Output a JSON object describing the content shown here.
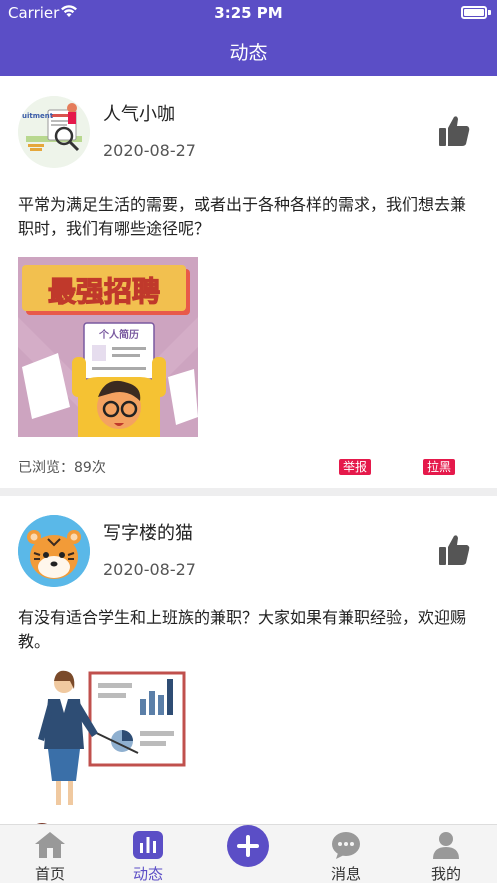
{
  "status_bar": {
    "carrier": "Carrier",
    "time": "3:25 PM"
  },
  "header": {
    "title": "动态"
  },
  "posts": [
    {
      "username": "人气小咖",
      "date": "2020-08-27",
      "content": "平常为满足生活的需要，或者出于各种各样的需求，我们想去兼职时，我们有哪些途径呢？",
      "image_text": "最强招聘",
      "image_subtext": "个人简历",
      "avatar_text": "uitment",
      "views": "已浏览：89次",
      "report_label": "举报",
      "block_label": "拉黑"
    },
    {
      "username": "写字楼的猫",
      "date": "2020-08-27",
      "content": "有没有适合学生和上班族的兼职？大家如果有兼职经验，欢迎赐教。"
    }
  ],
  "tabbar": {
    "home": "首页",
    "feed": "动态",
    "messages": "消息",
    "mine": "我的"
  },
  "colors": {
    "primary": "#5b4ec6",
    "tag": "#e5194b"
  }
}
